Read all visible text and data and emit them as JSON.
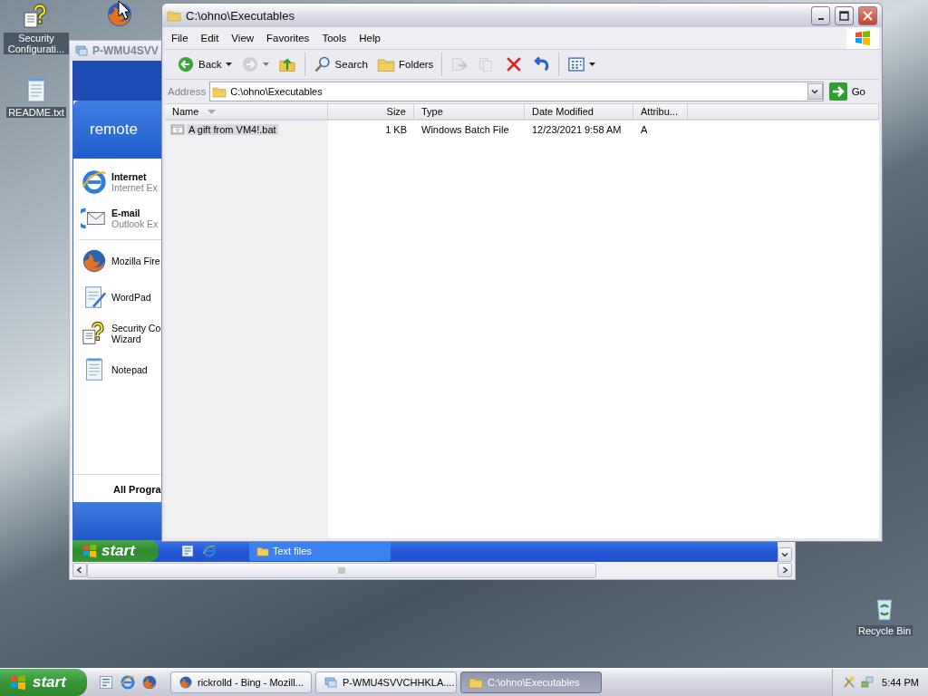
{
  "desktop_icons": [
    {
      "kind": "wizard",
      "label": "Security Configurati..."
    },
    {
      "kind": "firefox"
    },
    {
      "kind": "notepad",
      "label": "README.txt"
    },
    {
      "kind": "recycle",
      "label": "Recycle Bin"
    }
  ],
  "remote_window": {
    "title": "P-WMU4SVV",
    "start_menu": {
      "user": "remote",
      "items": [
        {
          "kind": "internet",
          "pinned": true,
          "title": "Internet",
          "subtitle": "Internet Ex"
        },
        {
          "kind": "email",
          "pinned": true,
          "title": "E-mail",
          "subtitle": "Outlook Ex"
        },
        {
          "kind": "firefox",
          "pinned": false,
          "title": "Mozilla Fire"
        },
        {
          "kind": "wordpad",
          "pinned": false,
          "title": "WordPad"
        },
        {
          "kind": "wizard",
          "pinned": false,
          "title": "Security Co",
          "subtitle": "Wizard"
        },
        {
          "kind": "notepad",
          "pinned": false,
          "title": "Notepad"
        }
      ],
      "all_programs": "All Progra"
    },
    "taskbar": {
      "start": "start",
      "quick_launch": [
        {
          "kind": "desktop"
        },
        {
          "kind": "ie"
        }
      ],
      "tasks": [
        {
          "kind": "folder",
          "label": "Text files"
        }
      ]
    }
  },
  "explorer": {
    "title": "C:\\ohno\\Executables",
    "menu": [
      "File",
      "Edit",
      "View",
      "Favorites",
      "Tools",
      "Help"
    ],
    "toolbar": [
      {
        "buttons": [
          {
            "kind": "back",
            "label": "Back",
            "disabled": false,
            "dropdown": true
          },
          {
            "kind": "forward",
            "disabled": true,
            "dropdown": true
          },
          {
            "kind": "up",
            "disabled": false,
            "dropdown": false
          }
        ]
      },
      {
        "buttons": [
          {
            "kind": "search",
            "label": "Search",
            "disabled": false,
            "dropdown": false
          },
          {
            "kind": "folders",
            "label": "Folders",
            "disabled": false,
            "dropdown": false
          }
        ]
      },
      {
        "buttons": [
          {
            "kind": "move",
            "disabled": true,
            "dropdown": false
          },
          {
            "kind": "copy",
            "disabled": true,
            "dropdown": false
          },
          {
            "kind": "delete",
            "disabled": false,
            "dropdown": false
          },
          {
            "kind": "undo",
            "disabled": false,
            "dropdown": false
          }
        ]
      },
      {
        "buttons": [
          {
            "kind": "views",
            "disabled": false,
            "dropdown": true
          }
        ]
      }
    ],
    "address": {
      "label": "Address",
      "value": "C:\\ohno\\Executables",
      "go": "Go"
    },
    "columns": [
      {
        "label": "Name",
        "sorted": true
      },
      {
        "label": "Size",
        "sorted": false
      },
      {
        "label": "Type",
        "sorted": false
      },
      {
        "label": "Date Modified",
        "sorted": false
      },
      {
        "label": "Attribu...",
        "sorted": false
      }
    ],
    "files": [
      {
        "kind": "batch",
        "selected": true,
        "cells": [
          "A gift from VM4!.bat",
          "1 KB",
          "Windows Batch File",
          "12/23/2021 9:58 AM",
          "A"
        ]
      }
    ]
  },
  "taskbar": {
    "start": "start",
    "quick_launch": [
      {
        "kind": "desktop"
      },
      {
        "kind": "ie"
      },
      {
        "kind": "firefox"
      }
    ],
    "tasks": [
      {
        "kind": "firefox",
        "label": "rickrolld - Bing - Mozill...",
        "selected": false
      },
      {
        "kind": "remote",
        "label": "P-WMU4SVVCHHKLA....",
        "selected": false
      },
      {
        "kind": "folder",
        "label": "C:\\ohno\\Executables",
        "selected": true
      }
    ],
    "tray": {
      "icons": [
        {
          "kind": "tools"
        },
        {
          "kind": "network"
        }
      ],
      "clock": "5:44 PM"
    }
  }
}
